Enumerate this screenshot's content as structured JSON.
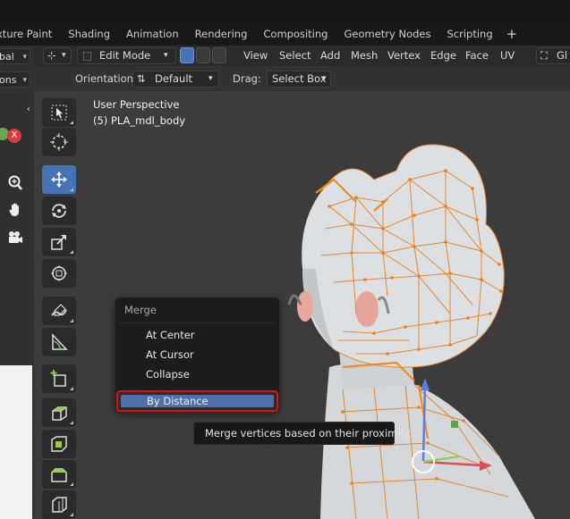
{
  "workspace_tabs": [
    "xture Paint",
    "Shading",
    "Animation",
    "Rendering",
    "Compositing",
    "Geometry Nodes",
    "Scripting"
  ],
  "left_panel": {
    "dropdown1": "bal",
    "dropdown2": "ons"
  },
  "header": {
    "mode_label": "Edit Mode",
    "menus": [
      "View",
      "Select",
      "Add",
      "Mesh",
      "Vertex",
      "Edge",
      "Face",
      "UV"
    ],
    "right_label": "Gl"
  },
  "header2": {
    "orientation_label": "Orientation:",
    "orientation_value": "Default",
    "drag_label": "Drag:",
    "drag_value": "Select Box"
  },
  "viewport": {
    "perspective": "User Perspective",
    "object_name": "(5) PLA_mdl_body"
  },
  "merge_menu": {
    "title": "Merge",
    "items": [
      "At Center",
      "At Cursor",
      "Collapse"
    ],
    "highlighted": "By Distance"
  },
  "tooltip": "Merge vertices based on their proximity.",
  "colors": {
    "accent": "#4772b3",
    "highlight_border": "#e01010",
    "mesh_edge": "#e8821e"
  },
  "tools": [
    "select-box-icon",
    "cursor-icon",
    "move-icon",
    "rotate-icon",
    "scale-icon",
    "transform-icon",
    "annotate-icon",
    "measure-icon",
    "add-cube-icon",
    "extrude-icon",
    "inset-icon",
    "bevel-icon",
    "loop-cut-icon"
  ]
}
